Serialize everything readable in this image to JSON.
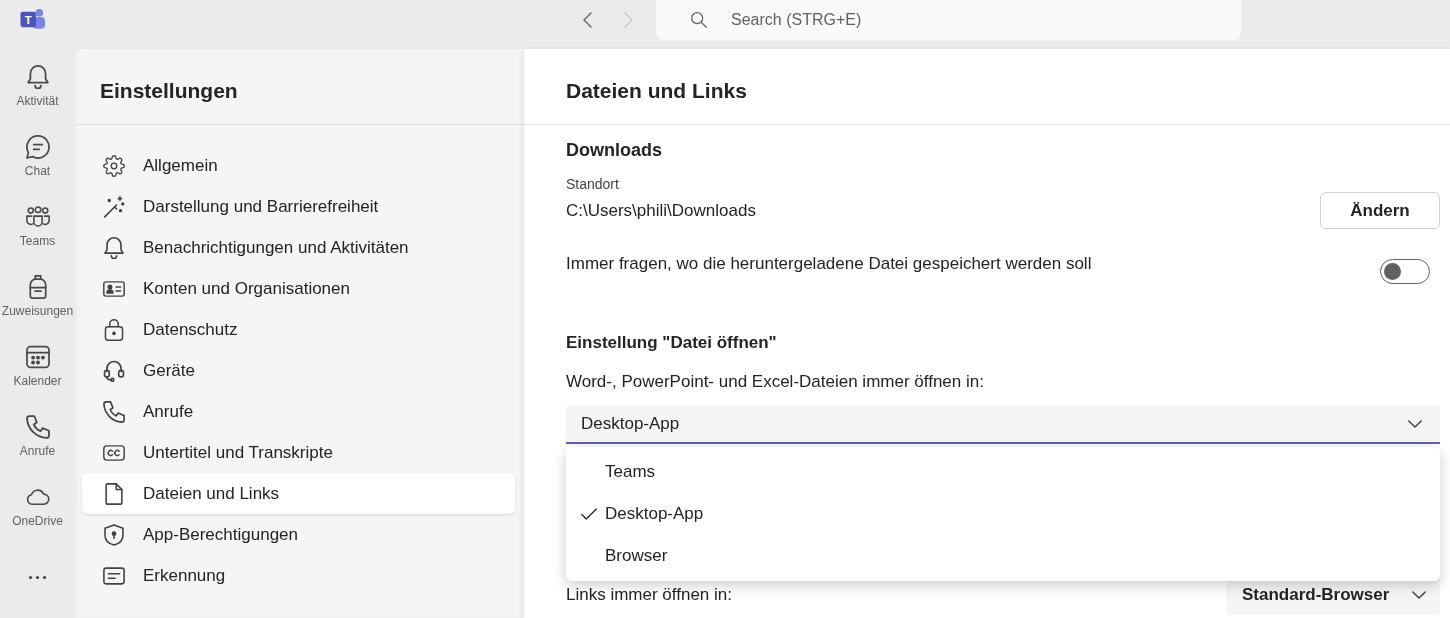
{
  "app_bar": {
    "logo": {
      "letter": "T"
    },
    "nav": [
      {
        "kind": "back",
        "disabled": false
      },
      {
        "kind": "forward",
        "disabled": true
      }
    ],
    "search": {
      "placeholder": "Search (STRG+E)"
    }
  },
  "rail": {
    "items": [
      {
        "label": "Aktivität"
      },
      {
        "label": "Chat"
      },
      {
        "label": "Teams"
      },
      {
        "label": "Zuweisungen"
      },
      {
        "label": "Kalender"
      },
      {
        "label": "Anrufe"
      },
      {
        "label": "OneDrive"
      }
    ]
  },
  "sidebar": {
    "title": "Einstellungen",
    "items": [
      {
        "label": "Allgemein",
        "selected": false
      },
      {
        "label": "Darstellung und Barrierefreiheit",
        "selected": false
      },
      {
        "label": "Benachrichtigungen und Aktivitäten",
        "selected": false
      },
      {
        "label": "Konten und Organisationen",
        "selected": false
      },
      {
        "label": "Datenschutz",
        "selected": false
      },
      {
        "label": "Geräte",
        "selected": false
      },
      {
        "label": "Anrufe",
        "selected": false
      },
      {
        "label": "Untertitel und Transkripte",
        "selected": false
      },
      {
        "label": "Dateien und Links",
        "selected": true
      },
      {
        "label": "App-Berechtigungen",
        "selected": false
      },
      {
        "label": "Erkennung",
        "selected": false
      }
    ]
  },
  "page": {
    "title": "Dateien und Links"
  },
  "downloads": {
    "heading": "Downloads",
    "location_label": "Standort",
    "location": "C:\\Users\\phili\\Downloads",
    "change_button": "Ändern",
    "ask_toggle": {
      "label": "Immer fragen, wo die heruntergeladene Datei gespeichert werden soll",
      "on": false
    }
  },
  "open_files": {
    "heading": "Einstellung \"Datei öffnen\"",
    "label": "Word-, PowerPoint- und Excel-Dateien immer öffnen in:",
    "dropdown": {
      "value": "Desktop-App",
      "expanded": true,
      "options": [
        {
          "label": "Teams",
          "selected": false
        },
        {
          "label": "Desktop-App",
          "selected": true
        },
        {
          "label": "Browser",
          "selected": false
        }
      ]
    }
  },
  "links": {
    "label": "Links immer öffnen in:",
    "dropdown": {
      "value": "Standard-Browser"
    }
  }
}
